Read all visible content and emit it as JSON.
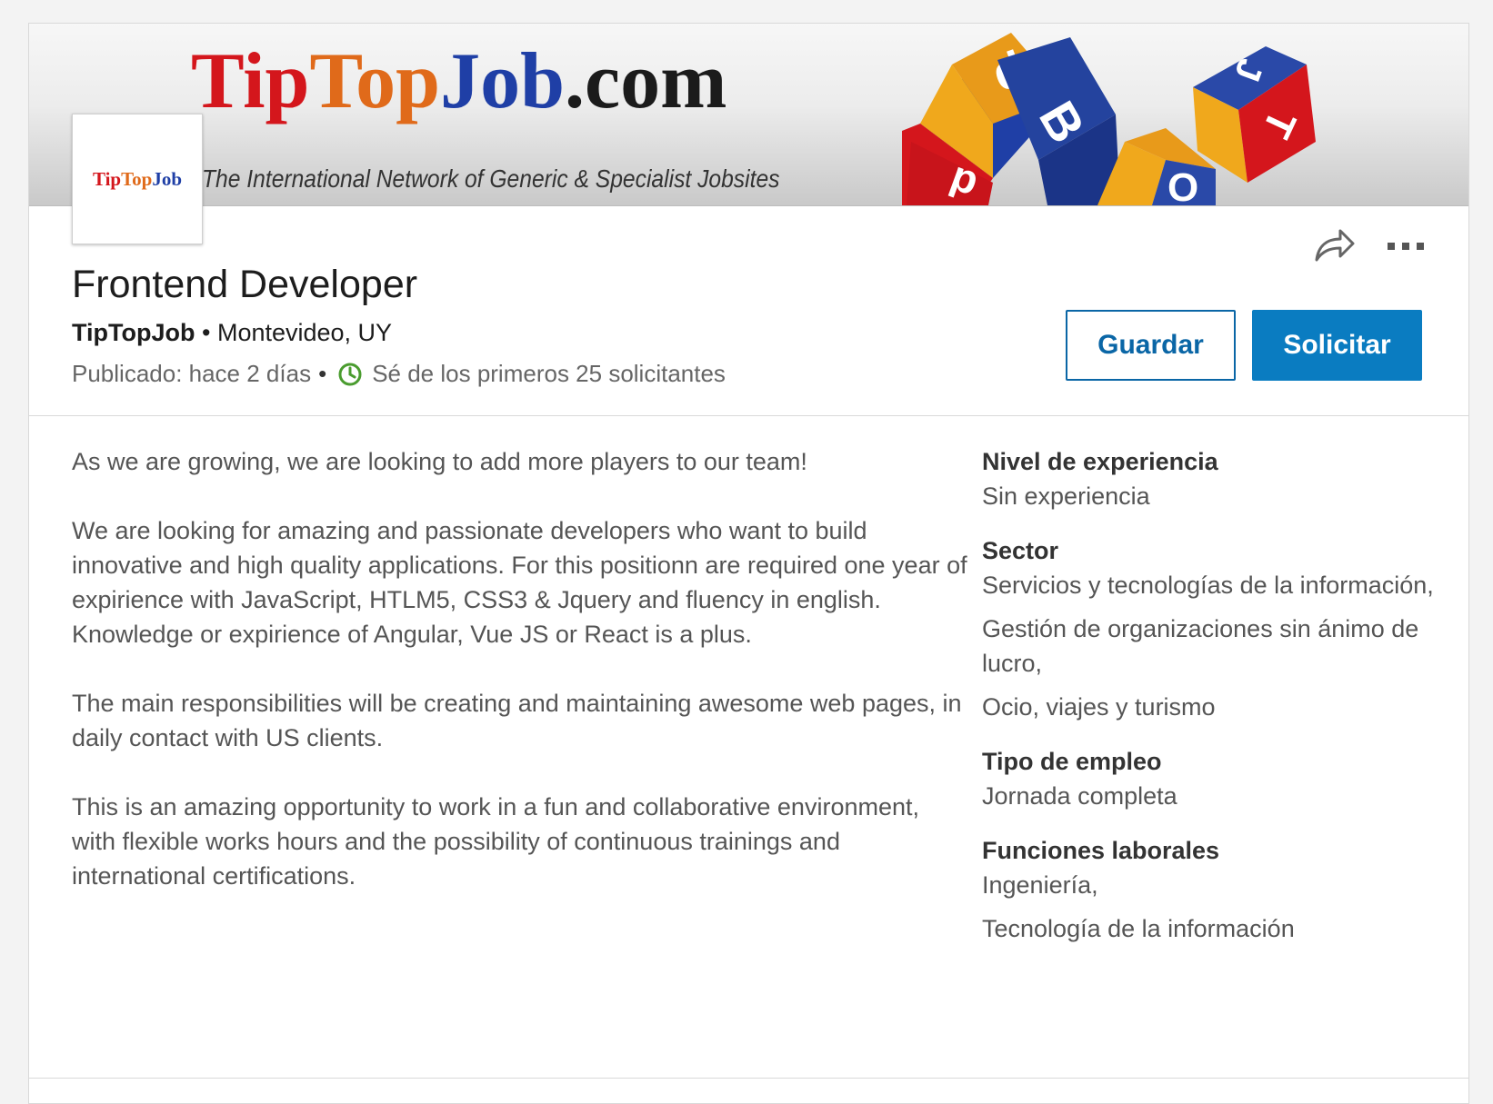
{
  "banner": {
    "brand_part1": "Tip",
    "brand_part2": "Top",
    "brand_part3": "Job",
    "brand_part4": ".com",
    "tagline": "The International Network of Generic & Specialist Jobsites",
    "cube_letters": [
      "d",
      "B",
      "d",
      "J",
      "T",
      "O"
    ]
  },
  "logo": {
    "part1": "Tip",
    "part2": "Top",
    "part3": "Job"
  },
  "job": {
    "title": "Frontend Developer",
    "company": "TipTopJob",
    "separator": "•",
    "location": "Montevideo, UY",
    "posted": "Publicado: hace 2 días",
    "applicants": "Sé de los primeros 25 solicitantes"
  },
  "actions": {
    "save_label": "Guardar",
    "apply_label": "Solicitar",
    "share_icon": "share-arrow-icon",
    "more_icon": "more-horizontal-icon"
  },
  "description": [
    "As we are growing, we are looking to add more players to our team!",
    "We are looking for amazing and passionate developers who want to build innovative and high quality applications. For this positionn are required one year of expirience with JavaScript, HTLM5, CSS3 & Jquery and fluency in english. Knowledge or expirience of Angular, Vue JS or React is a plus.",
    "The main responsibilities will be creating and maintaining awesome web pages, in daily contact with US clients.",
    "This is an amazing opportunity to work in a fun and collaborative environment, with flexible works hours and the possibility of continuous trainings and international certifications."
  ],
  "criteria": {
    "seniority": {
      "label": "Nivel de experiencia",
      "value": "Sin experiencia"
    },
    "sector": {
      "label": "Sector",
      "items": [
        "Servicios y tecnologías de la información,",
        "Gestión de organizaciones sin ánimo de lucro,",
        "Ocio, viajes y turismo"
      ]
    },
    "employment_type": {
      "label": "Tipo de empleo",
      "value": "Jornada completa"
    },
    "job_functions": {
      "label": "Funciones laborales",
      "items": [
        "Ingeniería,",
        "Tecnología de la información"
      ]
    }
  },
  "colors": {
    "primary": "#0a7cc1",
    "brand_red": "#d4161c",
    "brand_orange": "#e06a1a",
    "brand_blue": "#1f3fa6",
    "clock_green": "#4a9c2f"
  }
}
